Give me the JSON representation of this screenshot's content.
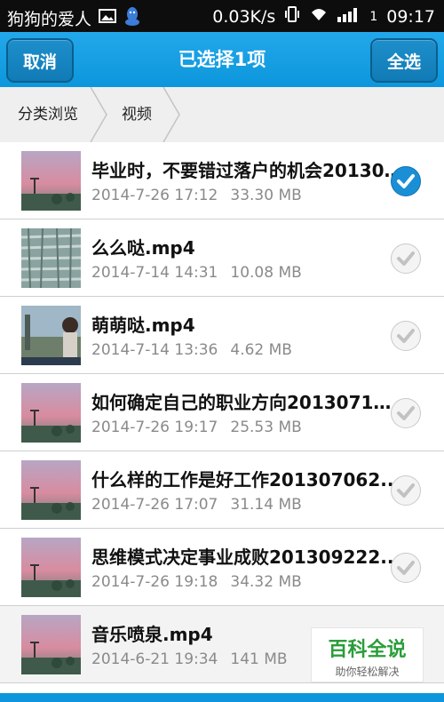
{
  "statusbar": {
    "notification_text": "狗狗的爱人",
    "speed": "0.03K/s",
    "sim_number": "1",
    "time": "09:17"
  },
  "titlebar": {
    "cancel_label": "取消",
    "title": "已选择1项",
    "select_all_label": "全选"
  },
  "breadcrumb": {
    "items": [
      "分类浏览",
      "视频"
    ]
  },
  "files": [
    {
      "name": "毕业时，不要错过落户的机会20130...",
      "date": "2014-7-26 17:12",
      "size": "33.30 MB",
      "selected": true,
      "thumb": "pink-sky"
    },
    {
      "name": "么么哒.mp4",
      "date": "2014-7-14 14:31",
      "size": "10.08 MB",
      "selected": false,
      "thumb": "wall"
    },
    {
      "name": "萌萌哒.mp4",
      "date": "2014-7-14 13:36",
      "size": "4.62 MB",
      "selected": false,
      "thumb": "people"
    },
    {
      "name": "如何确定自己的职业方向20130719...",
      "date": "2014-7-26 19:17",
      "size": "25.53 MB",
      "selected": false,
      "thumb": "pink-sky"
    },
    {
      "name": "什么样的工作是好工作201307062...",
      "date": "2014-7-26 17:07",
      "size": "31.14 MB",
      "selected": false,
      "thumb": "pink-sky"
    },
    {
      "name": "思维模式决定事业成败201309222...",
      "date": "2014-7-26 19:18",
      "size": "34.32 MB",
      "selected": false,
      "thumb": "pink-sky"
    },
    {
      "name": "音乐喷泉.mp4",
      "date": "2014-6-21 19:34",
      "size": "141 MB",
      "selected": false,
      "thumb": "pink-sky"
    }
  ],
  "watermark": {
    "title": "百科全说",
    "subtitle": "助你轻松解决"
  },
  "colors": {
    "titlebar": "#0d96dc",
    "check_on": "#1a8fd6",
    "watermark_green": "#2a9d39"
  }
}
